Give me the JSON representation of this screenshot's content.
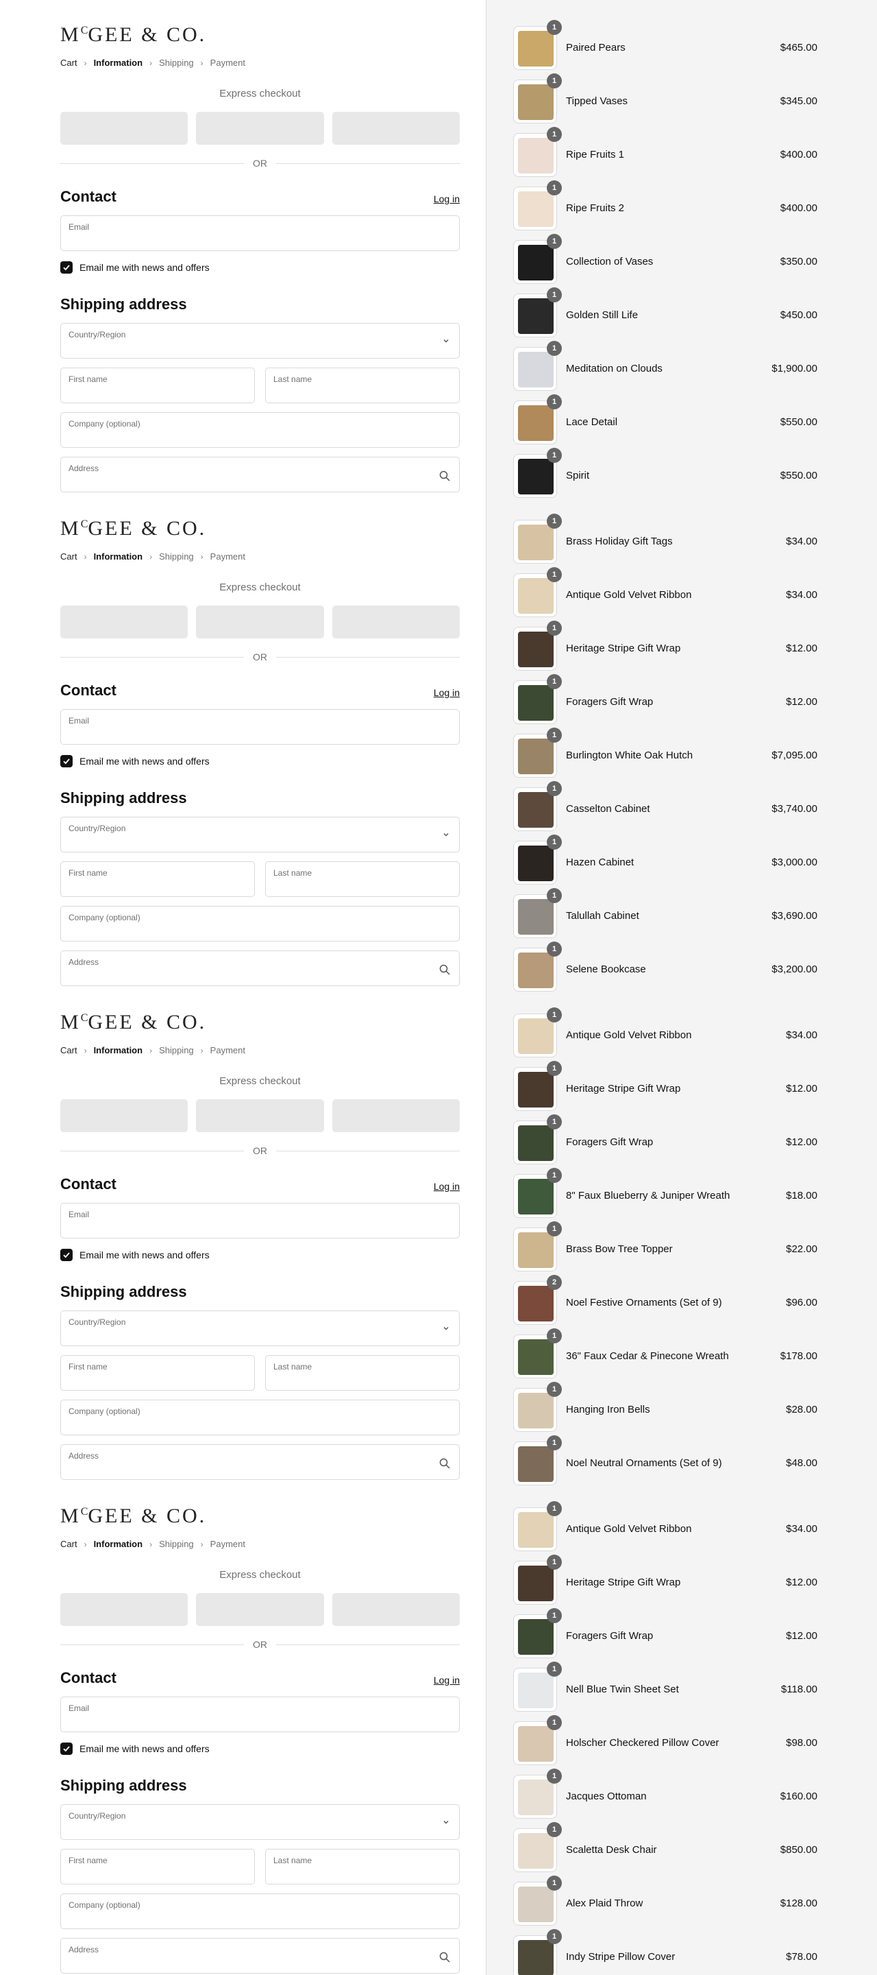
{
  "checkout": {
    "logo_main": "MCGEE & CO.",
    "logo_sup": "C",
    "breadcrumbs": [
      "Cart",
      "Information",
      "Shipping",
      "Payment"
    ],
    "express_checkout": "Express checkout",
    "or_label": "OR",
    "contact_heading": "Contact",
    "login_label": "Log in",
    "email_label": "Email",
    "newsletter_label": "Email me with news and offers",
    "shipping_heading": "Shipping address",
    "country_label": "Country/Region",
    "first_name_label": "First name",
    "last_name_label": "Last name",
    "company_label": "Company (optional)",
    "address_label": "Address"
  },
  "order_summary": {
    "groups": [
      {
        "items": [
          {
            "name": "Paired Pears",
            "price": "$465.00",
            "qty": "1",
            "color": "#c9a86a"
          },
          {
            "name": "Tipped Vases",
            "price": "$345.00",
            "qty": "1",
            "color": "#b59a6c"
          },
          {
            "name": "Ripe Fruits 1",
            "price": "$400.00",
            "qty": "1",
            "color": "#ecdcd2"
          },
          {
            "name": "Ripe Fruits 2",
            "price": "$400.00",
            "qty": "1",
            "color": "#eedfcf"
          },
          {
            "name": "Collection of Vases",
            "price": "$350.00",
            "qty": "1",
            "color": "#1d1d1d"
          },
          {
            "name": "Golden Still Life",
            "price": "$450.00",
            "qty": "1",
            "color": "#2a2a2a"
          },
          {
            "name": "Meditation on Clouds",
            "price": "$1,900.00",
            "qty": "1",
            "color": "#d8d9de"
          },
          {
            "name": "Lace Detail",
            "price": "$550.00",
            "qty": "1",
            "color": "#b08a5a"
          },
          {
            "name": "Spirit",
            "price": "$550.00",
            "qty": "1",
            "color": "#1f1f1f"
          }
        ]
      },
      {
        "items": [
          {
            "name": "Brass Holiday Gift Tags",
            "price": "$34.00",
            "qty": "1",
            "color": "#d7c3a4"
          },
          {
            "name": "Antique Gold Velvet Ribbon",
            "price": "$34.00",
            "qty": "1",
            "color": "#e3d2b6"
          },
          {
            "name": "Heritage Stripe Gift Wrap",
            "price": "$12.00",
            "qty": "1",
            "color": "#4a3a2e"
          },
          {
            "name": "Foragers Gift Wrap",
            "price": "$12.00",
            "qty": "1",
            "color": "#3d4a33"
          },
          {
            "name": "Burlington White Oak Hutch",
            "price": "$7,095.00",
            "qty": "1",
            "color": "#9a8468"
          },
          {
            "name": "Casselton Cabinet",
            "price": "$3,740.00",
            "qty": "1",
            "color": "#5d4a3c"
          },
          {
            "name": "Hazen Cabinet",
            "price": "$3,000.00",
            "qty": "1",
            "color": "#2b2522"
          },
          {
            "name": "Talullah Cabinet",
            "price": "$3,690.00",
            "qty": "1",
            "color": "#8f8a83"
          },
          {
            "name": "Selene Bookcase",
            "price": "$3,200.00",
            "qty": "1",
            "color": "#b79a7a"
          }
        ]
      },
      {
        "items": [
          {
            "name": "Antique Gold Velvet Ribbon",
            "price": "$34.00",
            "qty": "1",
            "color": "#e3d2b6"
          },
          {
            "name": "Heritage Stripe Gift Wrap",
            "price": "$12.00",
            "qty": "1",
            "color": "#4a3a2e"
          },
          {
            "name": "Foragers Gift Wrap",
            "price": "$12.00",
            "qty": "1",
            "color": "#3d4a33"
          },
          {
            "name": "8\" Faux Blueberry & Juniper Wreath",
            "price": "$18.00",
            "qty": "1",
            "color": "#3f5a3a"
          },
          {
            "name": "Brass Bow Tree Topper",
            "price": "$22.00",
            "qty": "1",
            "color": "#cdb58e"
          },
          {
            "name": "Noel Festive Ornaments (Set of 9)",
            "price": "$96.00",
            "qty": "2",
            "color": "#7a4a3a"
          },
          {
            "name": "36\" Faux Cedar & Pinecone Wreath",
            "price": "$178.00",
            "qty": "1",
            "color": "#4f5f3e"
          },
          {
            "name": "Hanging Iron Bells",
            "price": "$28.00",
            "qty": "1",
            "color": "#d6c8b0"
          },
          {
            "name": "Noel Neutral Ornaments (Set of 9)",
            "price": "$48.00",
            "qty": "1",
            "color": "#7d6a58"
          }
        ]
      },
      {
        "items": [
          {
            "name": "Antique Gold Velvet Ribbon",
            "price": "$34.00",
            "qty": "1",
            "color": "#e3d2b6"
          },
          {
            "name": "Heritage Stripe Gift Wrap",
            "price": "$12.00",
            "qty": "1",
            "color": "#4a3a2e"
          },
          {
            "name": "Foragers Gift Wrap",
            "price": "$12.00",
            "qty": "1",
            "color": "#3d4a33"
          },
          {
            "name": "Nell Blue Twin Sheet Set",
            "price": "$118.00",
            "qty": "1",
            "color": "#e6e8ea"
          },
          {
            "name": "Holscher Checkered Pillow Cover",
            "price": "$98.00",
            "qty": "1",
            "color": "#d9c7b1"
          },
          {
            "name": "Jacques Ottoman",
            "price": "$160.00",
            "qty": "1",
            "color": "#e8e0d4"
          },
          {
            "name": "Scaletta Desk Chair",
            "price": "$850.00",
            "qty": "1",
            "color": "#e6dbcd"
          },
          {
            "name": "Alex Plaid Throw",
            "price": "$128.00",
            "qty": "1",
            "color": "#d8cfc2"
          },
          {
            "name": "Indy Stripe Pillow Cover",
            "price": "$78.00",
            "qty": "1",
            "color": "#4d4a3a"
          }
        ]
      }
    ]
  }
}
